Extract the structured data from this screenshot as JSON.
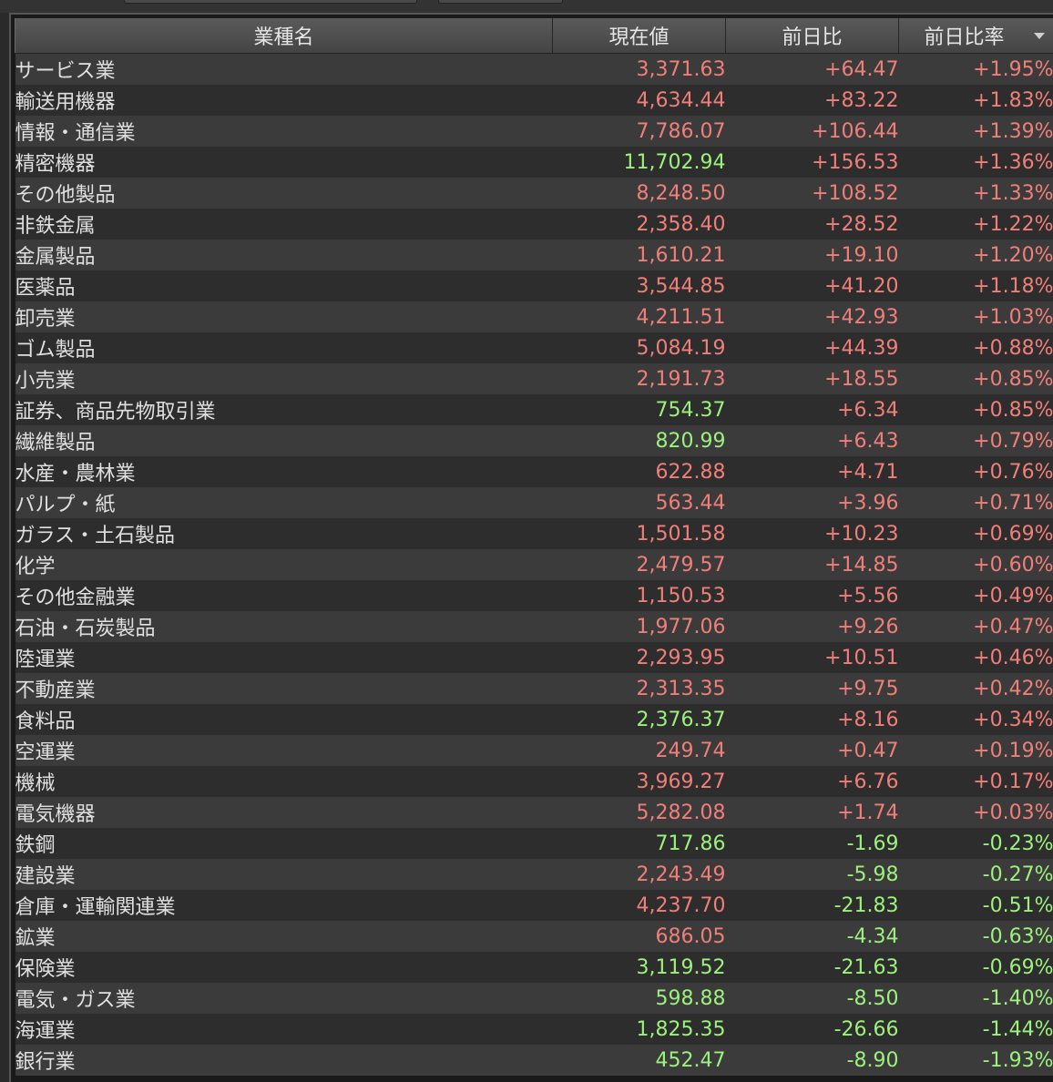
{
  "colors": {
    "up": "#f07f7a",
    "down": "#9cf27c"
  },
  "table": {
    "headers": {
      "name": "業種名",
      "price": "現在値",
      "change": "前日比",
      "change_rate": "前日比率"
    },
    "sort_icon": "sort-desc-icon",
    "rows": [
      {
        "name": "サービス業",
        "price": "3,371.63",
        "price_color": "red",
        "change": "+64.47",
        "rate": "+1.95%"
      },
      {
        "name": "輸送用機器",
        "price": "4,634.44",
        "price_color": "red",
        "change": "+83.22",
        "rate": "+1.83%"
      },
      {
        "name": "情報・通信業",
        "price": "7,786.07",
        "price_color": "red",
        "change": "+106.44",
        "rate": "+1.39%"
      },
      {
        "name": "精密機器",
        "price": "11,702.94",
        "price_color": "green",
        "change": "+156.53",
        "rate": "+1.36%"
      },
      {
        "name": "その他製品",
        "price": "8,248.50",
        "price_color": "red",
        "change": "+108.52",
        "rate": "+1.33%"
      },
      {
        "name": "非鉄金属",
        "price": "2,358.40",
        "price_color": "red",
        "change": "+28.52",
        "rate": "+1.22%"
      },
      {
        "name": "金属製品",
        "price": "1,610.21",
        "price_color": "red",
        "change": "+19.10",
        "rate": "+1.20%"
      },
      {
        "name": "医薬品",
        "price": "3,544.85",
        "price_color": "red",
        "change": "+41.20",
        "rate": "+1.18%"
      },
      {
        "name": "卸売業",
        "price": "4,211.51",
        "price_color": "red",
        "change": "+42.93",
        "rate": "+1.03%"
      },
      {
        "name": "ゴム製品",
        "price": "5,084.19",
        "price_color": "red",
        "change": "+44.39",
        "rate": "+0.88%"
      },
      {
        "name": "小売業",
        "price": "2,191.73",
        "price_color": "red",
        "change": "+18.55",
        "rate": "+0.85%"
      },
      {
        "name": "証券、商品先物取引業",
        "price": "754.37",
        "price_color": "green",
        "change": "+6.34",
        "rate": "+0.85%"
      },
      {
        "name": "繊維製品",
        "price": "820.99",
        "price_color": "green",
        "change": "+6.43",
        "rate": "+0.79%"
      },
      {
        "name": "水産・農林業",
        "price": "622.88",
        "price_color": "red",
        "change": "+4.71",
        "rate": "+0.76%"
      },
      {
        "name": "パルプ・紙",
        "price": "563.44",
        "price_color": "red",
        "change": "+3.96",
        "rate": "+0.71%"
      },
      {
        "name": "ガラス・土石製品",
        "price": "1,501.58",
        "price_color": "red",
        "change": "+10.23",
        "rate": "+0.69%"
      },
      {
        "name": "化学",
        "price": "2,479.57",
        "price_color": "red",
        "change": "+14.85",
        "rate": "+0.60%"
      },
      {
        "name": "その他金融業",
        "price": "1,150.53",
        "price_color": "red",
        "change": "+5.56",
        "rate": "+0.49%"
      },
      {
        "name": "石油・石炭製品",
        "price": "1,977.06",
        "price_color": "red",
        "change": "+9.26",
        "rate": "+0.47%"
      },
      {
        "name": "陸運業",
        "price": "2,293.95",
        "price_color": "red",
        "change": "+10.51",
        "rate": "+0.46%"
      },
      {
        "name": "不動産業",
        "price": "2,313.35",
        "price_color": "red",
        "change": "+9.75",
        "rate": "+0.42%"
      },
      {
        "name": "食料品",
        "price": "2,376.37",
        "price_color": "green",
        "change": "+8.16",
        "rate": "+0.34%"
      },
      {
        "name": "空運業",
        "price": "249.74",
        "price_color": "red",
        "change": "+0.47",
        "rate": "+0.19%"
      },
      {
        "name": "機械",
        "price": "3,969.27",
        "price_color": "red",
        "change": "+6.76",
        "rate": "+0.17%"
      },
      {
        "name": "電気機器",
        "price": "5,282.08",
        "price_color": "red",
        "change": "+1.74",
        "rate": "+0.03%"
      },
      {
        "name": "鉄鋼",
        "price": "717.86",
        "price_color": "green",
        "change": "-1.69",
        "rate": "-0.23%"
      },
      {
        "name": "建設業",
        "price": "2,243.49",
        "price_color": "red",
        "change": "-5.98",
        "rate": "-0.27%"
      },
      {
        "name": "倉庫・運輸関連業",
        "price": "4,237.70",
        "price_color": "red",
        "change": "-21.83",
        "rate": "-0.51%"
      },
      {
        "name": "鉱業",
        "price": "686.05",
        "price_color": "red",
        "change": "-4.34",
        "rate": "-0.63%"
      },
      {
        "name": "保険業",
        "price": "3,119.52",
        "price_color": "green",
        "change": "-21.63",
        "rate": "-0.69%"
      },
      {
        "name": "電気・ガス業",
        "price": "598.88",
        "price_color": "green",
        "change": "-8.50",
        "rate": "-1.40%"
      },
      {
        "name": "海運業",
        "price": "1,825.35",
        "price_color": "green",
        "change": "-26.66",
        "rate": "-1.44%"
      },
      {
        "name": "銀行業",
        "price": "452.47",
        "price_color": "green",
        "change": "-8.90",
        "rate": "-1.93%"
      }
    ]
  }
}
